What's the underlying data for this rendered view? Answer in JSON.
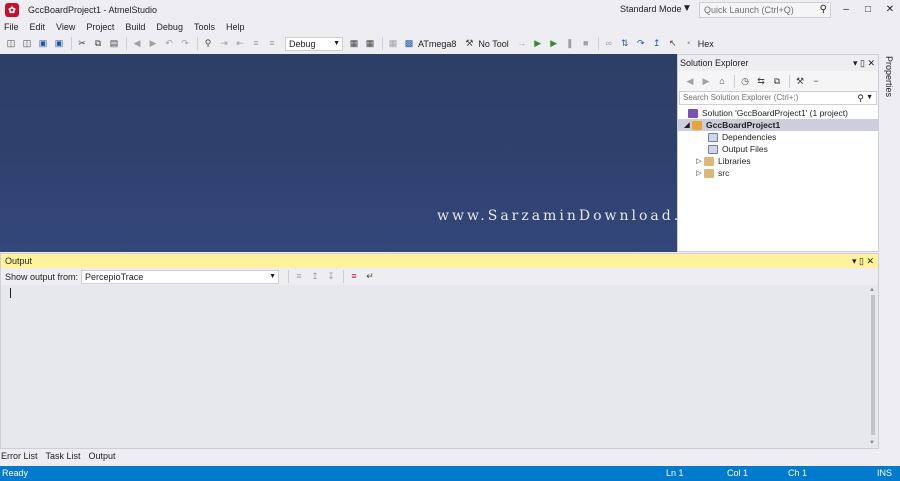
{
  "window": {
    "title": "GccBoardProject1 - AtmelStudio",
    "app_icon": "atmel-studio-icon",
    "mode": "Standard Mode",
    "quick_launch_placeholder": "Quick Launch (Ctrl+Q)",
    "controls": {
      "minimize": "–",
      "maximize": "□",
      "close": "✕"
    }
  },
  "menu": [
    "File",
    "Edit",
    "View",
    "Project",
    "Build",
    "Debug",
    "Tools",
    "Help"
  ],
  "toolbar": {
    "configuration": "Debug",
    "device": "ATmega8",
    "tool": "No Tool",
    "display_mode": "Hex"
  },
  "editor": {
    "watermark": "www.SarzaminDownload.com"
  },
  "solution_explorer": {
    "title": "Solution Explorer",
    "search_placeholder": "Search Solution Explorer (Ctrl+;)",
    "tree": [
      {
        "label": "Solution 'GccBoardProject1' (1 project)",
        "icon": "solution-icon"
      },
      {
        "label": "GccBoardProject1",
        "icon": "project-icon",
        "expanded": true,
        "selected": true
      },
      {
        "label": "Dependencies",
        "icon": "reference-icon"
      },
      {
        "label": "Output Files",
        "icon": "reference-icon"
      },
      {
        "label": "Libraries",
        "icon": "folder-icon",
        "expanded": false
      },
      {
        "label": "src",
        "icon": "folder-icon",
        "expanded": false
      }
    ]
  },
  "properties_tab": "Properties",
  "output": {
    "title": "Output",
    "show_from_label": "Show output from:",
    "source": "PercepioTrace"
  },
  "bottom_tabs": [
    "Error List",
    "Task List",
    "Output"
  ],
  "status": {
    "state": "Ready",
    "line": "Ln 1",
    "col": "Col 1",
    "ch": "Ch 1",
    "insert_mode": "INS"
  },
  "colors": {
    "status_bar": "#007acc",
    "editor_background": "#2f4270",
    "output_header": "#fff29d",
    "selection": "#cccedb"
  }
}
